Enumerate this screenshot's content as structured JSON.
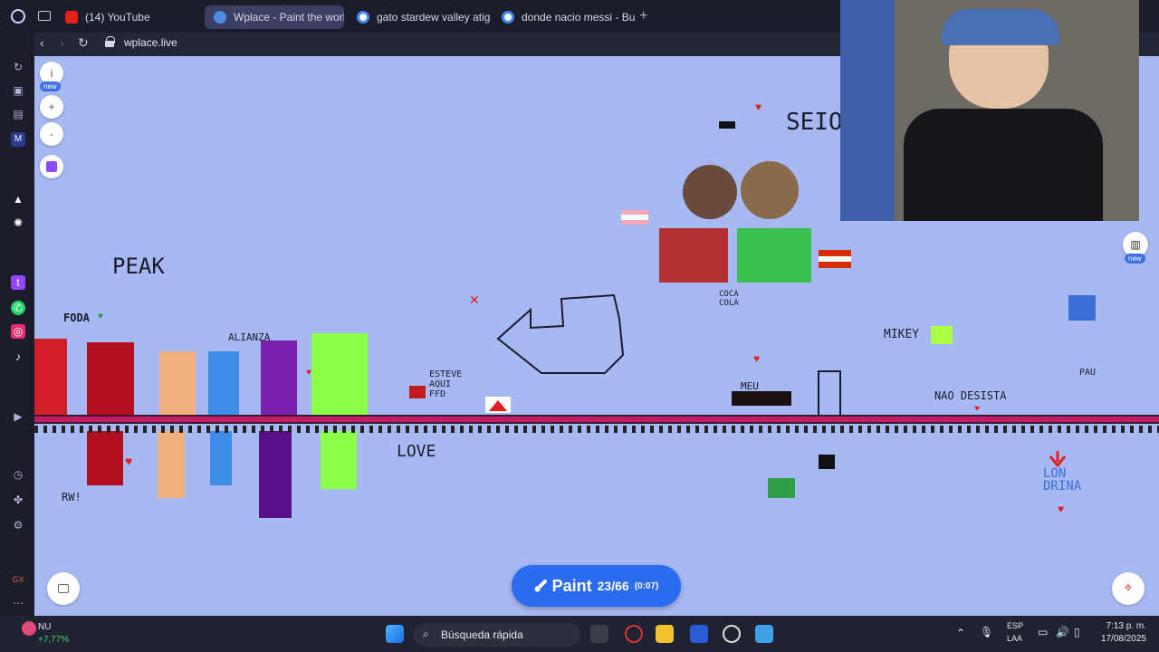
{
  "browser": {
    "tabs": [
      {
        "label": "(14) YouTube",
        "color": "#e62117"
      },
      {
        "label": "Wplace - Paint the world",
        "color": "#4c8be6"
      },
      {
        "label": "gato stardew valley atigra",
        "color": "#e8e8e8"
      },
      {
        "label": "donde nacio messi - Busc",
        "color": "#e8e8e8"
      }
    ],
    "new_tab": "+",
    "url": "wplace.live"
  },
  "canvas": {
    "info_label": "i",
    "new_badge": "new",
    "zoom_in": "+",
    "zoom_out": "-",
    "leaderboard_new_badge": "new",
    "texts": {
      "peak": "PEAK",
      "foda": "FODA",
      "alianza": "ALIANZA",
      "love": "LOVE",
      "rw": "RW!",
      "esteve": "ESTEVE\nAQUI\nFFD",
      "meu": "MEU",
      "mikey": "MIKEY",
      "nao_desista": "NAO DESISTA",
      "coca_cola": "COCA\nCOLA",
      "seio": "SEIO",
      "london": "LON\nDRINA",
      "pau": "PAU"
    },
    "background_color": "#a6b9f2",
    "ground_color": "#c21d63"
  },
  "paint_button": {
    "label": "Paint",
    "count": "23/66",
    "timer": "(0:07)"
  },
  "taskbar": {
    "stock_name": "NU",
    "stock_change": "+7,77%",
    "search_placeholder": "Búsqueda rápida",
    "lang_top": "ESP",
    "lang_bottom": "LAA",
    "time": "7:13 p. m.",
    "date": "17/08/2025"
  }
}
